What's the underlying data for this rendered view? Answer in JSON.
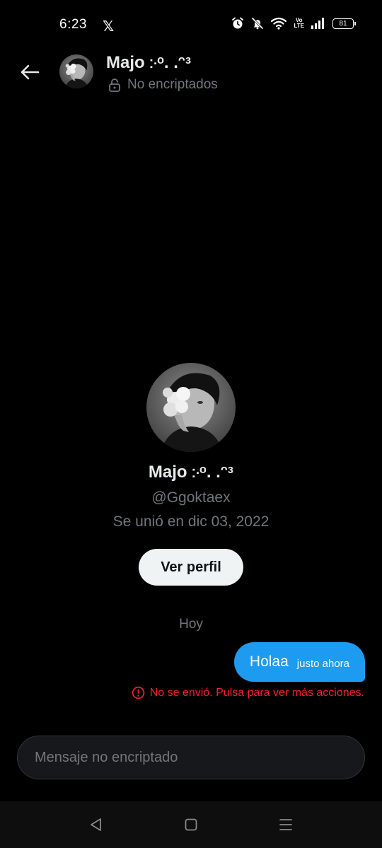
{
  "status_bar": {
    "time": "6:23",
    "app_icon": "x-logo-icon",
    "volte_top": "Vo",
    "volte_bottom": "LTE",
    "battery": "81"
  },
  "header": {
    "back_icon": "arrow-left-icon",
    "name": "Majo ჻ᵒ. .ᵔᵌ",
    "lock_icon": "unlock-icon",
    "subtitle": "No encriptados"
  },
  "profile": {
    "name": "Majo ჻ᵒ. .ᵔᵌ",
    "handle": "@Ggoktaex",
    "joined": "Se unió en dic 03, 2022",
    "view_profile_label": "Ver perfil"
  },
  "conversation": {
    "day_label": "Hoy",
    "messages": [
      {
        "text": "Holaa",
        "time": "justo ahora",
        "status": "No se envió. Pulsa para ver más acciones."
      }
    ]
  },
  "composer": {
    "placeholder": "Mensaje no encriptado"
  },
  "colors": {
    "background": "#000000",
    "accent": "#1d9bf0",
    "error": "#f4212e",
    "secondary_text": "#71767b",
    "primary_text": "#e7e9ea"
  }
}
